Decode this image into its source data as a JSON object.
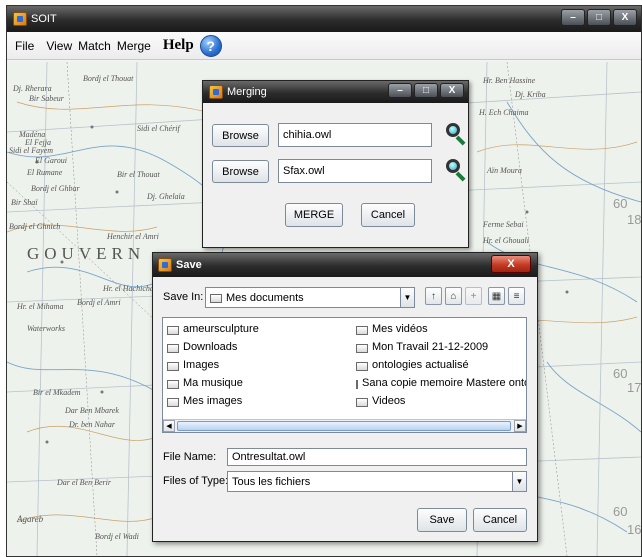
{
  "window": {
    "title": "SOIT",
    "min_label": "–",
    "max_label": "□",
    "close_label": "X"
  },
  "menu": {
    "file": "File",
    "view": "View",
    "match": "Match",
    "merge": "Merge",
    "help": "Help",
    "help_icon_glyph": "?"
  },
  "map": {
    "labels": [
      "Bordj el Thouat",
      "Dj. Rherara",
      "Bir Sabeur",
      "Madéna",
      "El Fejja",
      "Sidi el Fayem",
      "El Garoui",
      "El Rumane",
      "Bordj el Ghbar",
      "Sidi el Chérif",
      "Bir Sbaï",
      "Bordj el Ghnich",
      "Bir el Thouat",
      "Henchir el Amri",
      "Dj. Ghelaïa",
      "Hr. el Hachicha",
      "Bordj el Amri",
      "Hr. el Mihama",
      "Waterworks",
      "Dar Ben Mbarek",
      "Dr. ben Nahar",
      "Bir el Mkadem",
      "Dar el Ben Berir",
      "Agareb",
      "Bordj el Wadi",
      "Hr. Ben Hassine",
      "H. Ech Chaima",
      "Ferme Sebai",
      "Dj. Kriba",
      "Aïn Moura",
      "Hr. el Ghouali"
    ],
    "region_label": "GOUVERN",
    "grid_numbers": [
      "60",
      "18",
      "60",
      "17",
      "60",
      "16"
    ]
  },
  "merge_dialog": {
    "title": "Merging",
    "browse_label": "Browse",
    "file1": "chihia.owl",
    "file2": "Sfax.owl",
    "merge_label": "MERGE",
    "cancel_label": "Cancel"
  },
  "save_dialog": {
    "title": "Save",
    "close_label": "X",
    "save_in_label": "Save In:",
    "save_in_value": "Mes documents",
    "files_left": [
      "ameursculpture",
      "Downloads",
      "Images",
      "Ma musique",
      "Mes images"
    ],
    "files_right": [
      "Mes vidéos",
      "Mon Travail 21-12-2009",
      "ontologies actualisé",
      "Sana  copie memoire Mastere ontolc",
      "Videos"
    ],
    "file_name_label": "File Name:",
    "file_name_value": "Ontresultat.owl",
    "files_of_type_label": "Files of Type:",
    "files_of_type_value": "Tous les fichiers",
    "save_label": "Save",
    "cancel_label": "Cancel"
  }
}
